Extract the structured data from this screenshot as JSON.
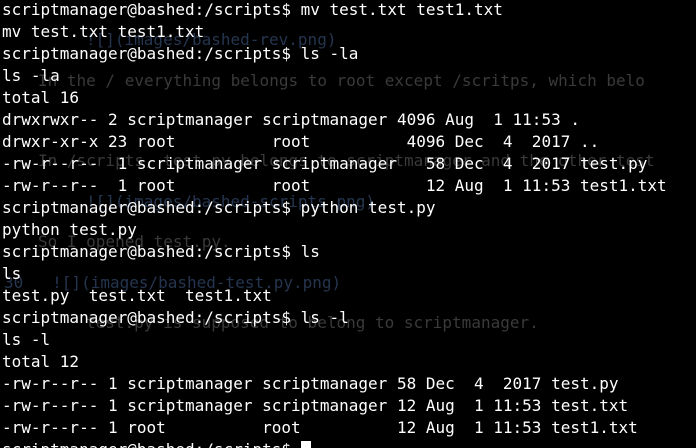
{
  "terminal": {
    "lines": [
      "scriptmanager@bashed:/scripts$ mv test.txt test1.txt",
      "mv test.txt test1.txt",
      "scriptmanager@bashed:/scripts$ ls -la",
      "ls -la",
      "total 16",
      "drwxrwxr-- 2 scriptmanager scriptmanager 4096 Aug  1 11:53 .",
      "drwxr-xr-x 23 root          root          4096 Dec  4  2017 ..",
      "-rw-r--r--  1 scriptmanager scriptmanager   58 Dec  4  2017 test.py",
      "-rw-r--r--  1 root          root            12 Aug  1 11:53 test1.txt",
      "scriptmanager@bashed:/scripts$ python test.py",
      "python test.py",
      "scriptmanager@bashed:/scripts$ ls",
      "ls",
      "test.py  test.txt  test1.txt",
      "scriptmanager@bashed:/scripts$ ls -l",
      "ls -l",
      "total 12",
      "-rw-r--r-- 1 scriptmanager scriptmanager 58 Dec  4  2017 test.py",
      "-rw-r--r-- 1 scriptmanager scriptmanager 12 Aug  1 11:53 test.txt",
      "-rw-r--r-- 1 root          root          12 Aug  1 11:53 test1.txt",
      "scriptmanager@bashed:/scripts$ "
    ],
    "background_color": "#000000",
    "text_color": "#ffffff"
  },
  "ghost_overlay": {
    "lines": [
      "![](images/bashed-rev.png)",
      "In the / everything belongs to root except /scritps, which belo",
      "In /scripts, test.py belongs to scriptmanager and the other test",
      "![](images/bashed-scripts.png)",
      "So I opened test.py.",
      "30   ![](images/bashed-test.py.png)",
      "test.py is supposed to belong to scriptmanager."
    ]
  }
}
